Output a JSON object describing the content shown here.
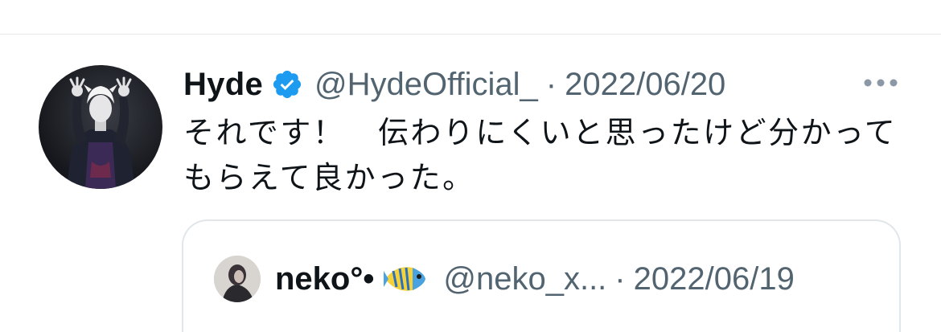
{
  "tweet": {
    "display_name": "Hyde",
    "handle": "@HydeOfficial_",
    "separator": "·",
    "date": "2022/06/20",
    "text": "それです！　伝わりにくいと思ったけど分かってもらえて良かった。",
    "verified": true,
    "more_icon": "more-horizontal-icon"
  },
  "quoted_tweet": {
    "display_name": "neko°•",
    "emoji": "tropical-fish-icon",
    "handle": "@neko_x...",
    "separator": "·",
    "date": "2022/06/19"
  },
  "colors": {
    "text_primary": "#0f1419",
    "text_secondary": "#536471",
    "verified_blue": "#1d9bf0",
    "border": "#e1e6ea"
  }
}
